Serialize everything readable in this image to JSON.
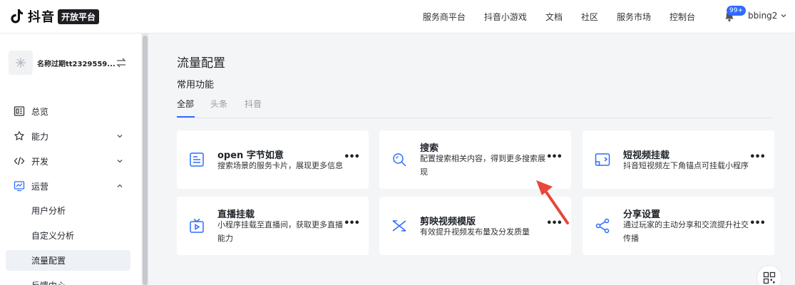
{
  "header": {
    "logo_text": "抖音",
    "logo_badge": "开放平台",
    "nav": [
      "服务商平台",
      "抖音小游戏",
      "文档",
      "社区",
      "服务市场",
      "控制台"
    ],
    "notification_count": "99+",
    "username": "bbing2"
  },
  "sidebar": {
    "app_name": "名称过期tt2329559...",
    "menu": [
      "总览",
      "能力",
      "开发",
      "运营"
    ],
    "submenu": [
      "用户分析",
      "自定义分析",
      "流量配置",
      "反馈中心"
    ]
  },
  "main": {
    "page_title": "流量配置",
    "section_title": "常用功能",
    "tabs": [
      "全部",
      "头条",
      "抖音"
    ],
    "cards": [
      {
        "title": "open 字节如意",
        "desc": "搜索场景的服务卡片，展现更多信息",
        "icon": "card-icon"
      },
      {
        "title": "搜索",
        "desc": "配置搜索相关内容，得到更多搜索展现",
        "icon": "search-icon"
      },
      {
        "title": "短视频挂载",
        "desc": "抖音短视频左下角锚点可挂载小程序",
        "icon": "video-mount-icon"
      },
      {
        "title": "直播挂载",
        "desc": "小程序挂载至直播间，获取更多直播能力",
        "icon": "live-icon"
      },
      {
        "title": "剪映视频模版",
        "desc": "有效提升视频发布量及分发质量",
        "icon": "capcut-icon"
      },
      {
        "title": "分享设置",
        "desc": "通过玩家的主动分享和交流提升社交传播",
        "icon": "share-icon"
      }
    ]
  },
  "colors": {
    "accent": "#2f6bff",
    "annotation_arrow": "#e8473a"
  }
}
